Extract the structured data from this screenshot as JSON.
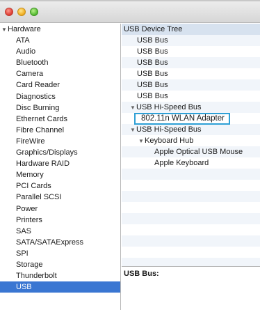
{
  "window": {
    "controls": [
      "close",
      "minimize",
      "zoom"
    ]
  },
  "sidebar": {
    "section": "Hardware",
    "items": [
      {
        "label": "ATA"
      },
      {
        "label": "Audio"
      },
      {
        "label": "Bluetooth"
      },
      {
        "label": "Camera"
      },
      {
        "label": "Card Reader"
      },
      {
        "label": "Diagnostics"
      },
      {
        "label": "Disc Burning"
      },
      {
        "label": "Ethernet Cards"
      },
      {
        "label": "Fibre Channel"
      },
      {
        "label": "FireWire"
      },
      {
        "label": "Graphics/Displays"
      },
      {
        "label": "Hardware RAID"
      },
      {
        "label": "Memory"
      },
      {
        "label": "PCI Cards"
      },
      {
        "label": "Parallel SCSI"
      },
      {
        "label": "Power"
      },
      {
        "label": "Printers"
      },
      {
        "label": "SAS"
      },
      {
        "label": "SATA/SATAExpress"
      },
      {
        "label": "SPI"
      },
      {
        "label": "Storage"
      },
      {
        "label": "Thunderbolt"
      },
      {
        "label": "USB"
      }
    ],
    "selected": "USB"
  },
  "tree": {
    "header": "USB Device Tree",
    "rows": [
      {
        "label": "USB Bus"
      },
      {
        "label": "USB Bus"
      },
      {
        "label": "USB Bus"
      },
      {
        "label": "USB Bus"
      },
      {
        "label": "USB Bus"
      },
      {
        "label": "USB Bus"
      },
      {
        "label": "USB Hi-Speed Bus"
      },
      {
        "label": "802.11n WLAN Adapter"
      },
      {
        "label": "USB Hi-Speed Bus"
      },
      {
        "label": "Keyboard Hub"
      },
      {
        "label": "Apple Optical USB Mouse"
      },
      {
        "label": "Apple Keyboard"
      }
    ]
  },
  "details": {
    "label": "USB Bus:"
  },
  "colors": {
    "selection": "#3a76d2",
    "highlight_box": "#2fa0d6",
    "header_bg": "#d7e2ef"
  }
}
